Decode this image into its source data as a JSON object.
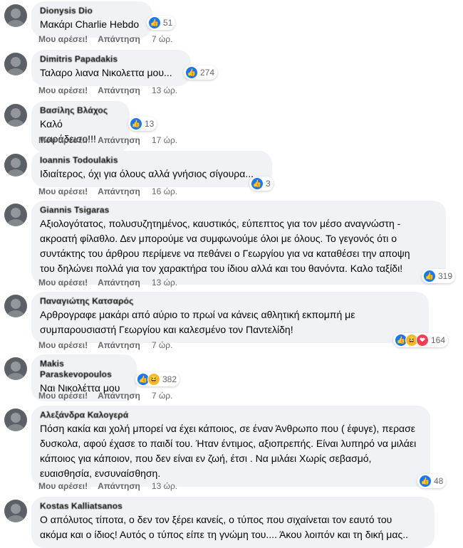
{
  "labels": {
    "like": "Μου αρέσει!",
    "reply": "Απάντηση"
  },
  "comments": [
    {
      "author": "Dionysis Dio",
      "text": [
        "Μακάρι Charlie Hebdo"
      ],
      "count": "51",
      "time": "7 ώρ.",
      "reactions": [
        "like"
      ]
    },
    {
      "author": "Dimitris Papadakis",
      "text": [
        "Ταλαρο λιανα Νικολεττα μου..."
      ],
      "count": "274",
      "time": "13 ώρ.",
      "reactions": [
        "like"
      ]
    },
    {
      "author": "Βασίλης Βλάχος",
      "text": [
        "Καλό παράδεισο!!!"
      ],
      "count": "13",
      "time": "17 ώρ.",
      "reactions": [
        "like"
      ]
    },
    {
      "author": "Ioannis Todoulakis",
      "text": [
        "Ιδιαίτερος, όχι για όλους αλλά γνήσιος σίγουρα..."
      ],
      "count": "3",
      "time": "16 ώρ.",
      "reactions": [
        "like"
      ]
    },
    {
      "author": "Giannis Tsigaras",
      "text": [
        "Αξιολογότατος, πολυσυζητημένος, καυστικός, εύπεπτος για τον μέσο αναγνώστη -",
        "ακροατή φίλαθλο. Δεν μπορούμε να συμφωνούμε όλοι με όλους. Το γεγονός ότι ο",
        "συντάκτης του άρθρου περίμενε να πεθάνει ο Γεωργίου για να καταθέσει την αποψη",
        "του δηλώνει πολλά για τον χαρακτήρα του ίδιου αλλά και του θανόντα. Καλο ταξίδι!"
      ],
      "count": "319",
      "time": "13 ώρ.",
      "reactions": [
        "like"
      ]
    },
    {
      "author": "Παναγιώτης Κατσαρός",
      "text": [
        "Αρθρογραφε μακάρι από αύριο το πρωί να κάνεις αθλητική εκπομπή με",
        "συμπαρουσιαστή Γεωργίου και καλεσμένο τον Παντελίδη!"
      ],
      "count": "164",
      "time": "7 ώρ.",
      "reactions": [
        "like",
        "haha",
        "heart"
      ]
    },
    {
      "author": "Makis Paraskevopoulos",
      "text": [
        "Ναι Νικολέττα μου"
      ],
      "count": "382",
      "time": "7 ώρ.",
      "reactions": [
        "like",
        "haha"
      ]
    },
    {
      "author": "Αλεξάνδρα Καλογερά",
      "text": [
        "Πόση κακία και χολή μπορεί να έχει κάποιος, σε έναν Άνθρωπο που ( έφυγε), περασε",
        "δυσκολα, αφού έχασε το παιδί του. Ήταν έντιμος, αξιοπρεπής. Είναι λυπηρό να μιλάει",
        "κάποιος για κάποιον, που δεν είναι εν ζωή, έτσι . Να μιλάει Χωρίς σεβασμό,",
        "ευαισθησία, ενσυναίσθηση."
      ],
      "count": "48",
      "time": "13 ώρ.",
      "reactions": [
        "like"
      ]
    },
    {
      "author": "Kostas Kalliatsanos",
      "text": [
        "Ο απόλυτος τίποτα, ο δεν τον ξέρει κανείς, ο τύπος που σιχαίνεται τον εαυτό του",
        "ακόμα και ο ίδιος! Αυτός ο τύπος είπε τη γνώμη του.... Άκου λοιπόν και τη δική μας.."
      ],
      "count": "",
      "time": "",
      "reactions": []
    }
  ],
  "icons": {
    "like": "👍",
    "haha": "😆",
    "heart": "❤"
  }
}
